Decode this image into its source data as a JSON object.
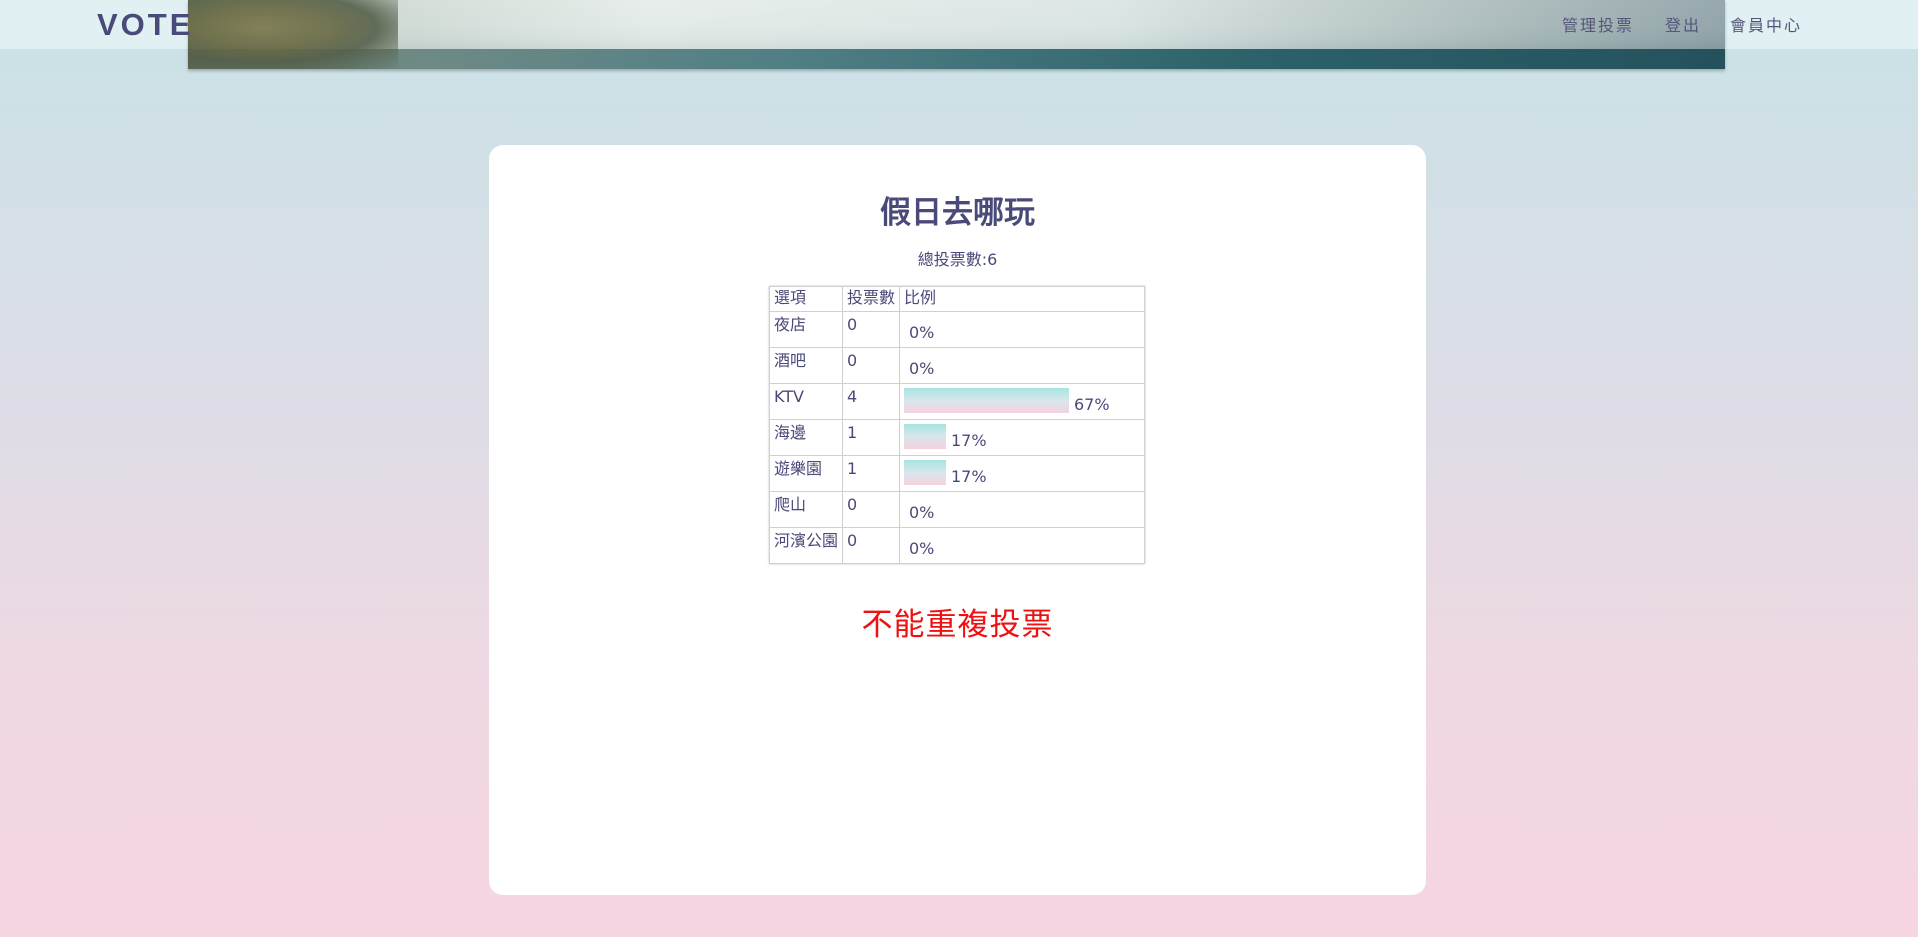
{
  "header": {
    "logo": "VOTE",
    "nav": [
      {
        "label": "管理投票"
      },
      {
        "label": "登出"
      },
      {
        "label": "會員中心"
      }
    ]
  },
  "poll": {
    "title": "假日去哪玩",
    "total_label": "總投票數:6",
    "columns": [
      "選項",
      "投票數",
      "比例"
    ],
    "rows": [
      {
        "option": "夜店",
        "votes": "0",
        "percent": "0%",
        "ratio": 0
      },
      {
        "option": "酒吧",
        "votes": "0",
        "percent": "0%",
        "ratio": 0
      },
      {
        "option": "KTV",
        "votes": "4",
        "percent": "67%",
        "ratio": 0.67
      },
      {
        "option": "海邊",
        "votes": "1",
        "percent": "17%",
        "ratio": 0.17
      },
      {
        "option": "遊樂園",
        "votes": "1",
        "percent": "17%",
        "ratio": 0.17
      },
      {
        "option": "爬山",
        "votes": "0",
        "percent": "0%",
        "ratio": 0
      },
      {
        "option": "河濱公園",
        "votes": "0",
        "percent": "0%",
        "ratio": 0
      }
    ],
    "message": "不能重複投票",
    "message_color": "#ee1111"
  }
}
